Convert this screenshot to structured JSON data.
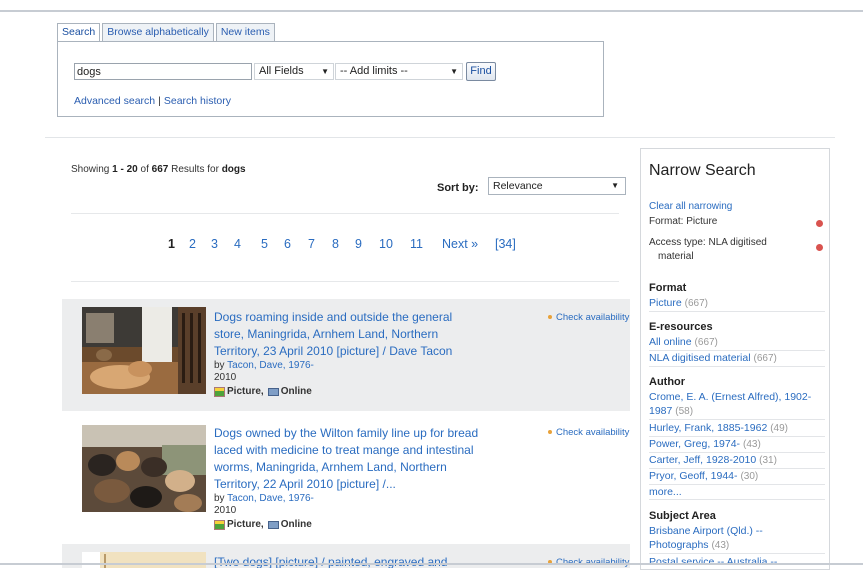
{
  "tabs": [
    "Search",
    "Browse alphabetically",
    "New items"
  ],
  "search": {
    "query": "dogs",
    "field": "All Fields",
    "limits": "-- Add limits --",
    "find_label": "Find",
    "advanced_link": "Advanced search",
    "history_link": "Search history",
    "separator": "|"
  },
  "results": {
    "showing_prefix": "Showing",
    "range_start": "1",
    "range_dash": "-",
    "range_end": "20",
    "of_word": "of",
    "total": "667",
    "results_for": "Results for",
    "term": "dogs",
    "sort_label": "Sort by:",
    "sort_value": "Relevance",
    "pages": [
      "1",
      "2",
      "3",
      "4",
      "5",
      "6",
      "7",
      "8",
      "9",
      "10",
      "11"
    ],
    "next_label": "Next »",
    "last_page": "[34]",
    "items": [
      {
        "title_lines": [
          "Dogs roaming inside and outside the general",
          "store, Maningrida, Arnhem Land, Northern",
          "Territory, 23 April 2010 [picture] / Dave Tacon"
        ],
        "by": "by",
        "author": "Tacon, Dave, 1976-",
        "year": "2010",
        "format1": "Picture,",
        "format2": "Online",
        "availability": "Check availability"
      },
      {
        "title_lines": [
          "Dogs owned by the Wilton family line up for bread",
          "laced with medicine to treat mange and intestinal",
          "worms, Maningrida, Arnhem Land, Northern",
          "Territory, 22 April 2010 [picture] /..."
        ],
        "by": "by",
        "author": "Tacon, Dave, 1976-",
        "year": "2010",
        "format1": "Picture,",
        "format2": "Online",
        "availability": "Check availability"
      },
      {
        "title_lines": [
          "[Two dogs] [picture] / painted, engraved and"
        ],
        "availability": "Check availability"
      }
    ]
  },
  "narrow": {
    "title": "Narrow Search",
    "clear": "Clear all narrowing",
    "applied": [
      "Format: Picture",
      "Access type: NLA digitised",
      "material"
    ],
    "groups": {
      "format": {
        "label": "Format",
        "items": [
          {
            "name": "Picture",
            "count": "(667)"
          }
        ]
      },
      "eres": {
        "label": "E-resources",
        "items": [
          {
            "name": "All online",
            "count": "(667)"
          },
          {
            "name": "NLA digitised material",
            "count": "(667)"
          }
        ]
      },
      "author": {
        "label": "Author",
        "items": [
          {
            "name": "Crome, E. A. (Ernest Alfred), 1902-",
            "name2": "1987",
            "count": "(58)"
          },
          {
            "name": "Hurley, Frank, 1885-1962",
            "count": "(49)"
          },
          {
            "name": "Power, Greg, 1974-",
            "count": "(43)"
          },
          {
            "name": "Carter, Jeff, 1928-2010",
            "count": "(31)"
          },
          {
            "name": "Pryor, Geoff, 1944-",
            "count": "(30)"
          },
          {
            "name": "more...",
            "count": ""
          }
        ]
      },
      "subject": {
        "label": "Subject Area",
        "items": [
          {
            "name": "Brisbane Airport (Qld.) --",
            "name2": "Photographs",
            "count": "(43)"
          },
          {
            "name": "Postal service -- Australia --",
            "count": ""
          }
        ]
      }
    }
  },
  "colors": {
    "link": "#2a6cc0",
    "shade": "#ecedee",
    "remove": "#d9534f",
    "availability_dot": "#e8a23a"
  }
}
